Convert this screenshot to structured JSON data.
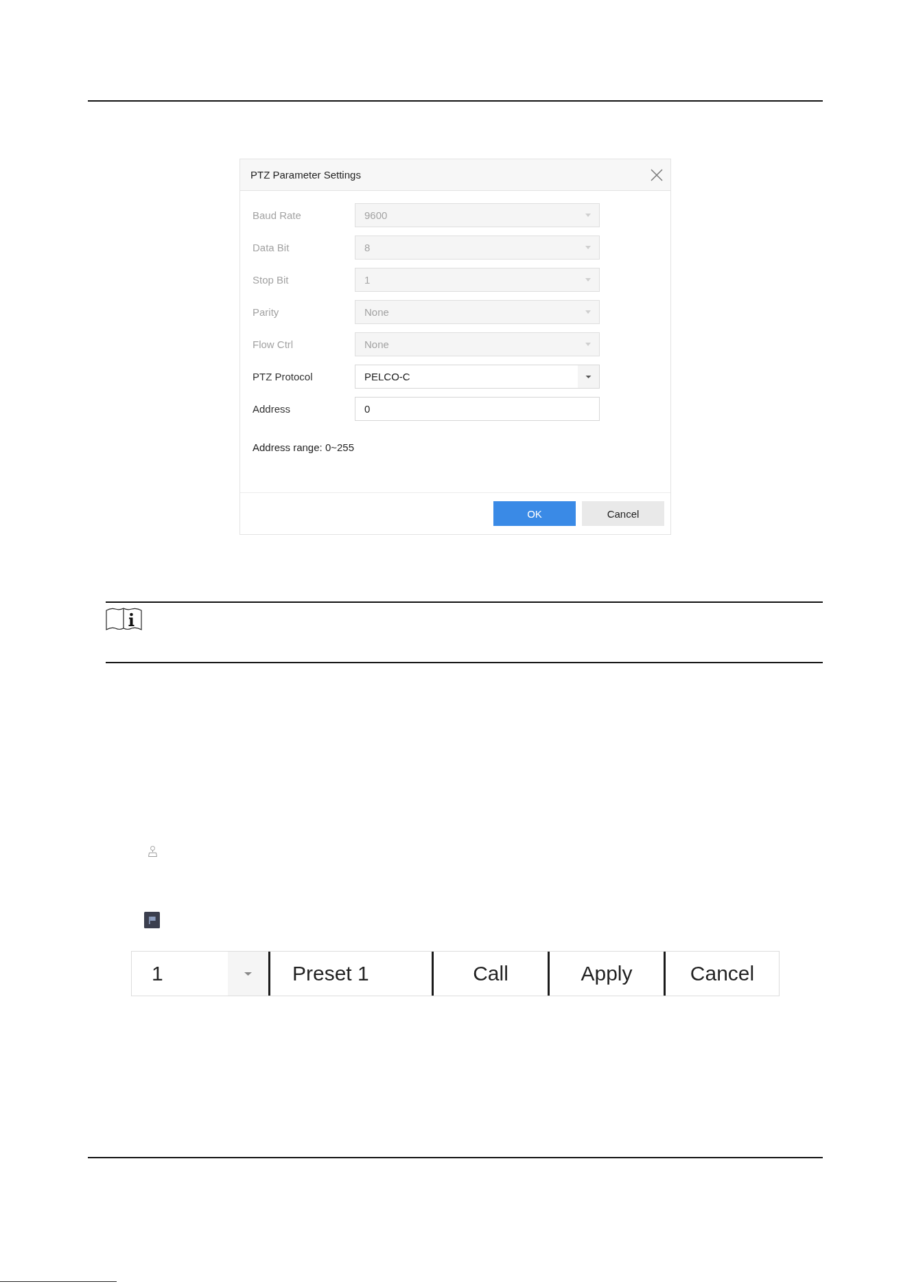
{
  "dialog": {
    "title": "PTZ Parameter Settings",
    "fields": [
      {
        "label": "Baud Rate",
        "kind": "dropdown",
        "value": "9600",
        "disabled": true
      },
      {
        "label": "Data Bit",
        "kind": "dropdown",
        "value": "8",
        "disabled": true
      },
      {
        "label": "Stop Bit",
        "kind": "dropdown",
        "value": "1",
        "disabled": true
      },
      {
        "label": "Parity",
        "kind": "dropdown",
        "value": "None",
        "disabled": true
      },
      {
        "label": "Flow Ctrl",
        "kind": "dropdown",
        "value": "None",
        "disabled": true
      },
      {
        "label": "PTZ Protocol",
        "kind": "dropdown",
        "value": "PELCO-C",
        "disabled": false
      },
      {
        "label": "Address",
        "kind": "text",
        "value": "0",
        "disabled": false
      }
    ],
    "hint": "Address range: 0~255",
    "buttons": [
      {
        "label": "OK",
        "kind": "primary"
      },
      {
        "label": "Cancel",
        "kind": "secondary"
      }
    ]
  },
  "preset_bar": {
    "number": "1",
    "name": "Preset 1",
    "buttons": [
      "Call",
      "Apply",
      "Cancel"
    ]
  }
}
